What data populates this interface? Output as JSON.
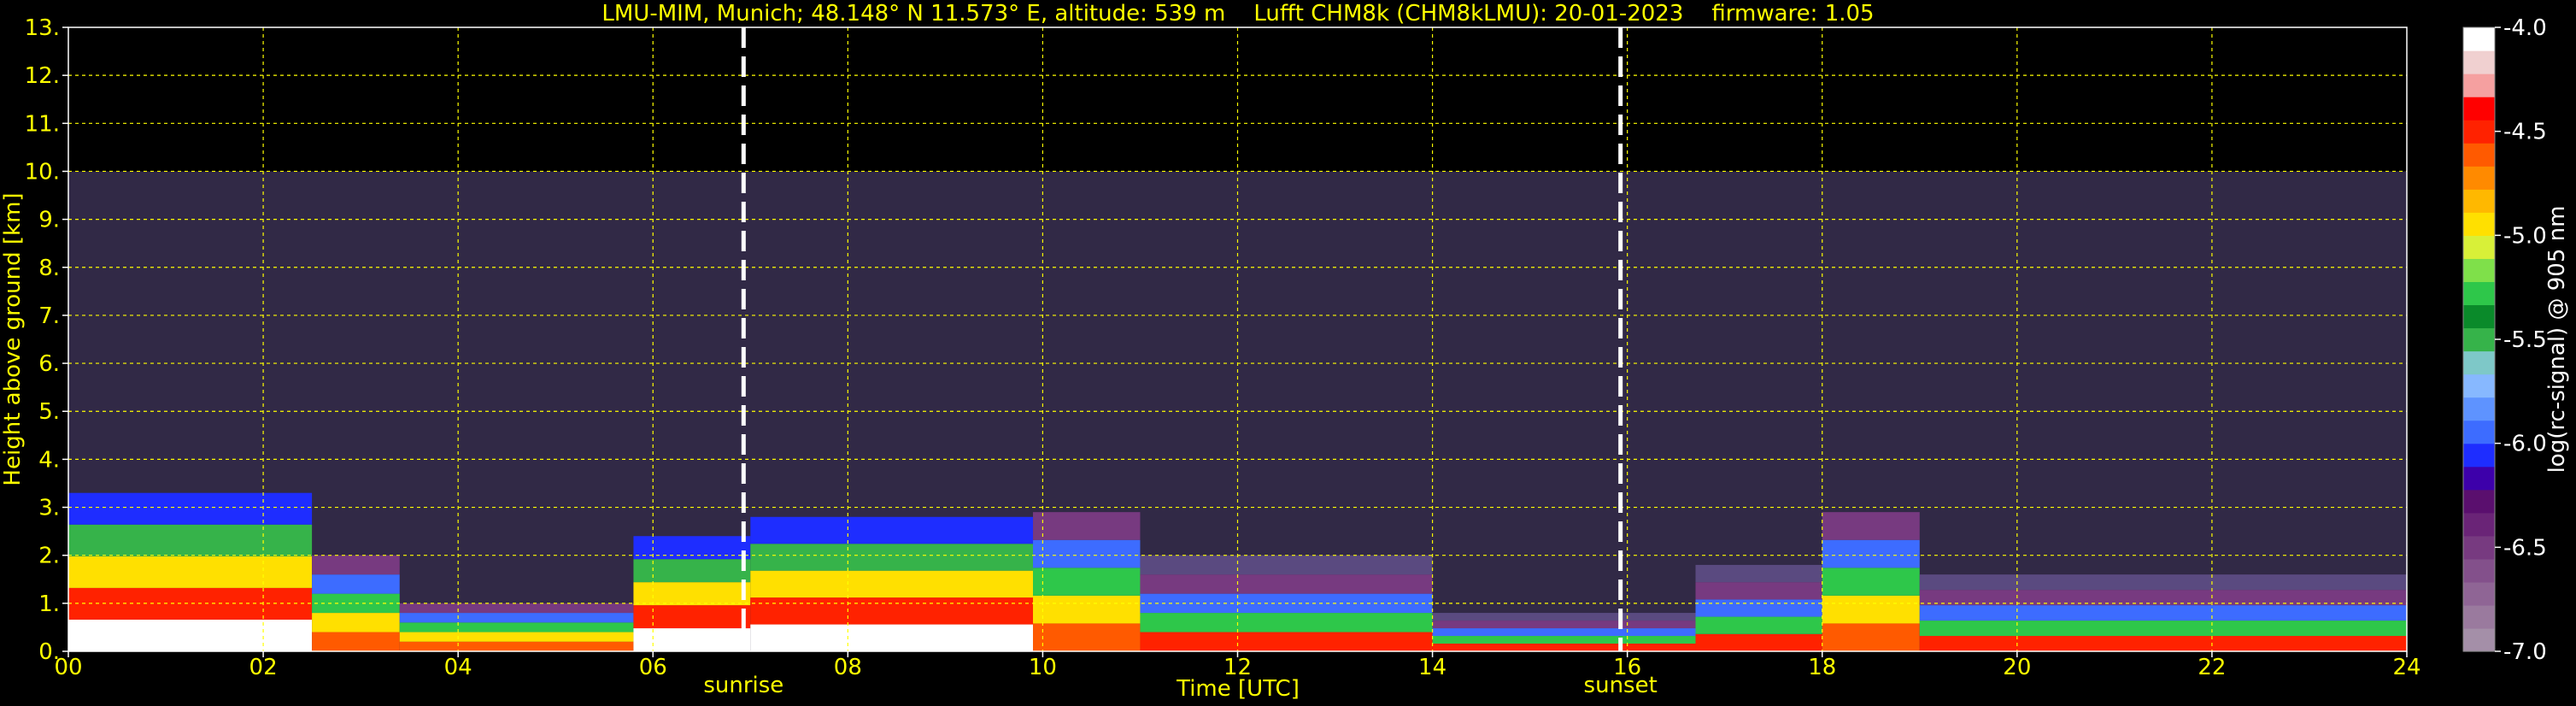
{
  "chart_data": {
    "type": "heatmap",
    "title": "LMU-MIM, Munich; 48.148° N 11.573° E, altitude: 539 m    Lufft CHM8k (CHM8kLMU): 20-01-2023    firmware: 1.05",
    "xlabel": "Time [UTC]",
    "ylabel": "Height above ground [km]",
    "xlim": [
      0,
      24
    ],
    "ylim": [
      0,
      13
    ],
    "x_ticks": [
      0,
      2,
      4,
      6,
      8,
      10,
      12,
      14,
      16,
      18,
      20,
      22,
      24
    ],
    "x_tick_labels": [
      "00",
      "02",
      "04",
      "06",
      "08",
      "10",
      "12",
      "14",
      "16",
      "18",
      "20",
      "22",
      "24"
    ],
    "y_ticks": [
      0,
      1,
      2,
      3,
      4,
      5,
      6,
      7,
      8,
      9,
      10,
      11,
      12,
      13
    ],
    "y_tick_labels": [
      "0.",
      "1.",
      "2.",
      "3.",
      "4.",
      "5.",
      "6.",
      "7.",
      "8.",
      "9.",
      "10.",
      "11.",
      "12.",
      "13."
    ],
    "grid": true,
    "data_ceiling_km": 10.0,
    "markers": [
      {
        "label": "sunrise",
        "x": 6.93
      },
      {
        "label": "sunset",
        "x": 15.93
      }
    ],
    "colorbar": {
      "label": "log(rc-signal) @ 905 nm",
      "range": [
        -7.0,
        -4.0
      ],
      "ticks": [
        -7.0,
        -6.5,
        -6.0,
        -5.5,
        -5.0,
        -4.5,
        -4.0
      ],
      "tick_labels": [
        "-7.0",
        "-6.5",
        "-6.0",
        "-5.5",
        "-5.0",
        "-4.5",
        "-4.0"
      ],
      "colors_bottom_to_top": [
        "#a48fa8",
        "#9a7a9e",
        "#8f6595",
        "#83508b",
        "#773a80",
        "#6a2477",
        "#5a0f6e",
        "#3d00aa",
        "#1e2dff",
        "#3d6cff",
        "#5e93ff",
        "#87b8ff",
        "#7ec8c8",
        "#36b34a",
        "#0a8a2a",
        "#2ec74a",
        "#7fe04a",
        "#d8f038",
        "#ffe000",
        "#ffb800",
        "#ff8a00",
        "#ff5a00",
        "#ff2200",
        "#ff0000",
        "#f5a0a0",
        "#f0d0d0",
        "#ffffff"
      ]
    },
    "backscatter_summary": [
      {
        "start": 0.0,
        "end": 2.5,
        "height_km": 3.3,
        "strength": "strong"
      },
      {
        "start": 2.5,
        "end": 3.4,
        "height_km": 2.0,
        "strength": "medium"
      },
      {
        "start": 3.4,
        "end": 5.8,
        "height_km": 1.0,
        "strength": "medium"
      },
      {
        "start": 5.8,
        "end": 7.0,
        "height_km": 2.4,
        "strength": "strong"
      },
      {
        "start": 7.0,
        "end": 9.9,
        "height_km": 2.8,
        "strength": "strong"
      },
      {
        "start": 9.9,
        "end": 11.0,
        "height_km": 2.9,
        "strength": "medium"
      },
      {
        "start": 11.0,
        "end": 14.0,
        "height_km": 2.0,
        "strength": "weak"
      },
      {
        "start": 14.0,
        "end": 16.7,
        "height_km": 0.8,
        "strength": "weak"
      },
      {
        "start": 16.7,
        "end": 18.0,
        "height_km": 1.8,
        "strength": "weak"
      },
      {
        "start": 18.0,
        "end": 19.0,
        "height_km": 2.9,
        "strength": "medium"
      },
      {
        "start": 19.0,
        "end": 24.0,
        "height_km": 1.6,
        "strength": "weak"
      }
    ]
  }
}
